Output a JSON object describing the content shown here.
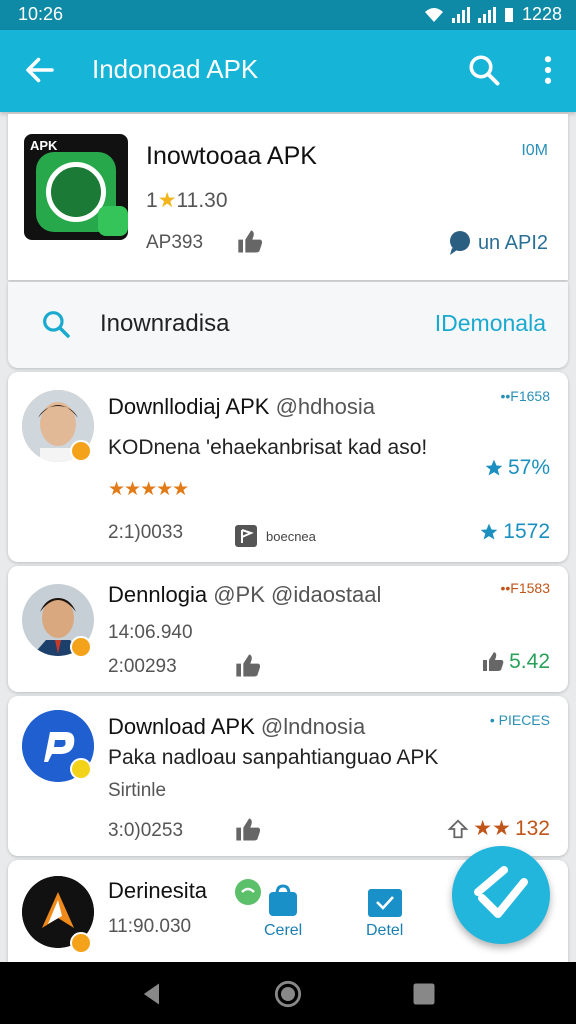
{
  "status_bar": {
    "time": "10:26",
    "clock": "1228"
  },
  "app_bar": {
    "title": "Indonoad APK",
    "back_icon": "arrow-left-icon",
    "search_icon": "search-icon",
    "more_icon": "more-vert-icon"
  },
  "featured": {
    "icon_label": "APK",
    "name": "Inowtooaa APK",
    "rating_prefix": "1",
    "rating_value": "11.30",
    "code": "AP393",
    "size": "I0M",
    "location": "un API2"
  },
  "search_row": {
    "text": "Inownradisa",
    "link": "IDemonala"
  },
  "items": [
    {
      "title_main": "Downllodiaj APK",
      "title_accent": "@hdhosia",
      "subtitle": "KODnena 'ehaekanbrisat kad aso!",
      "stars": "★★★★★",
      "corner": "••F1658",
      "stat_top": "57%",
      "meta": "2:1)0033",
      "tag": "boecnea",
      "stat_bottom": "1572"
    },
    {
      "title_main": "Dennlogia",
      "title_accent": "@PK @idaostaal",
      "line2": "14:06.940",
      "meta": "2:00293",
      "corner": "••F1583",
      "stat": "5.42"
    },
    {
      "title_main": "Download APK",
      "title_accent": "@lndnosia",
      "subtitle": "Paka nadloau sanpahtianguao APK",
      "line3": "Sirtinle",
      "meta": "3:0)0253",
      "corner": "• PIECES",
      "stat": "132",
      "stat_stars": "★★"
    },
    {
      "title_main": "Derinesita",
      "line2": "11:90.030",
      "tab1": "Cerel",
      "tab2": "Detel"
    }
  ],
  "colors": {
    "primary": "#16b4d6",
    "status": "#0f8aa6",
    "accent_orange": "#e07b18",
    "link_blue": "#1aa9cf"
  }
}
